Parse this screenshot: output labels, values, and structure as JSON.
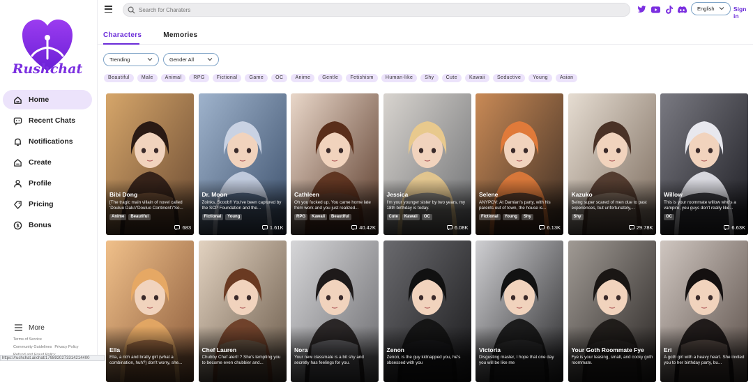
{
  "brand": {
    "name": "Rushchat",
    "color": "#7b2fe0"
  },
  "nav": [
    {
      "label": "Home",
      "icon": "home-icon",
      "active": true
    },
    {
      "label": "Recent Chats",
      "icon": "chat-icon"
    },
    {
      "label": "Notifications",
      "icon": "bell-icon"
    },
    {
      "label": "Create",
      "icon": "create-icon"
    },
    {
      "label": "Profile",
      "icon": "user-icon"
    },
    {
      "label": "Pricing",
      "icon": "tag-icon"
    },
    {
      "label": "Bonus",
      "icon": "coin-icon"
    }
  ],
  "more_label": "More",
  "footer": {
    "terms": "Terms of Service",
    "guidelines": "Community Guidelines",
    "privacy": "Privacy Policy",
    "refund": "Refund and Fraud Policy"
  },
  "status_url": "https://rushchat.ai/chat/1798920273314214400",
  "search": {
    "placeholder": "Search for Charaters"
  },
  "social": [
    "twitter-icon",
    "youtube-icon",
    "tiktok-icon",
    "discord-icon"
  ],
  "language": "English",
  "signin": "Sign in",
  "tabs": [
    {
      "label": "Characters",
      "active": true
    },
    {
      "label": "Memories"
    }
  ],
  "filters": {
    "sort": "Trending",
    "gender": "Gender All"
  },
  "tags": [
    "Beautiful",
    "Male",
    "Animal",
    "RPG",
    "Fictional",
    "Game",
    "OC",
    "Anime",
    "Gentle",
    "Fetishism",
    "Human-like",
    "Shy",
    "Cute",
    "Kawaii",
    "Seductive",
    "Young",
    "Asian"
  ],
  "cards": [
    {
      "name": "Bibi Dong",
      "desc": "[The tragic main villain of novel called 'Douluo Dalu'/'Douluo Continent'/'So...",
      "tags": [
        "Anime",
        "Beautiful"
      ],
      "count": "683",
      "c1": "#6a4a32",
      "c2": "#d6a66a",
      "hair": "#2a1a14"
    },
    {
      "name": "Dr. Moon",
      "desc": "Zoinks, Scoob!! You've been captured by the SCP Foundation and the...",
      "tags": [
        "Fictional",
        "Young"
      ],
      "count": "1.61K",
      "c1": "#3b4f6b",
      "c2": "#9fb3cc",
      "hair": "#c9d2e3"
    },
    {
      "name": "Cathleen",
      "desc": "Oh you fucked up. You came home late from work and you just realized...",
      "tags": [
        "RPG",
        "Kawaii",
        "Beautiful"
      ],
      "count": "40.42K",
      "c1": "#5a3a2a",
      "c2": "#e9d7c9",
      "hair": "#5a2e1a"
    },
    {
      "name": "Jessica",
      "desc": "I'm your younger sister by two years, my 18th birthday is today.",
      "tags": [
        "Cute",
        "Kawaii",
        "OC"
      ],
      "count": "6.08K",
      "c1": "#6d6f72",
      "c2": "#d8d4cf",
      "hair": "#e8c98d"
    },
    {
      "name": "Selene",
      "desc": "ANYPOV: At Damian's party, with his parents out of town, the house is...",
      "tags": [
        "Fictional",
        "Young",
        "Shy"
      ],
      "count": "6.13K",
      "c1": "#3e2e24",
      "c2": "#c98a56",
      "hair": "#e07a3a"
    },
    {
      "name": "Kazuko",
      "desc": "Being super scared of men due to past experiences, but unfortunately,...",
      "tags": [
        "Shy"
      ],
      "count": "29.78K",
      "c1": "#7a6a5c",
      "c2": "#e6ddd2",
      "hair": "#4a3226"
    },
    {
      "name": "Willow",
      "desc": "This is your roommate willow who's a vampire, you guys don't really like...",
      "tags": [
        "OC"
      ],
      "count": "6.63K",
      "c1": "#1c1c22",
      "c2": "#7a7a82",
      "hair": "#e8e8ee"
    },
    {
      "name": "Ella",
      "desc": "Ella, a rich and bratty girl (what a combination, huh?) don't worry, she...",
      "tags": [],
      "count": "",
      "c1": "#8a5a3a",
      "c2": "#f0c08a",
      "hair": "#e6a864"
    },
    {
      "name": "Chef Lauren",
      "desc": "Chubby Chef alert! ? She's tempting you to become even chubbier and...",
      "tags": [],
      "count": "",
      "c1": "#6a5a4a",
      "c2": "#e2d2c0",
      "hair": "#6a3a22"
    },
    {
      "name": "Nora",
      "desc": "Your new classmate is a bit shy and secretly has feelings for you.",
      "tags": [],
      "count": "",
      "c1": "#6a6a6e",
      "c2": "#d6d6d8",
      "hair": "#1e1a1a"
    },
    {
      "name": "Zenon",
      "desc": "Zenon, is the guy kidnapped you, he's obsessed with you",
      "tags": [],
      "count": "",
      "c1": "#1a1a1c",
      "c2": "#6a6a6e",
      "hair": "#111"
    },
    {
      "name": "Victoria",
      "desc": "Disgusting master, I hope that one day you will be like me",
      "tags": [],
      "count": "",
      "c1": "#2a2a2c",
      "c2": "#cfcfd2",
      "hair": "#121212"
    },
    {
      "name": "Your Goth Roommate Fye",
      "desc": "Fye is your teasing, small, and cocky goth roommate.",
      "tags": [],
      "count": "",
      "c1": "#2a2624",
      "c2": "#a09a94",
      "hair": "#1a1614"
    },
    {
      "name": "Eri",
      "desc": "A goth girl with a heavy heart. She invited you to her birthday party, bu...",
      "tags": [],
      "count": "",
      "c1": "#5a4e48",
      "c2": "#cfc6c0",
      "hair": "#141010"
    }
  ]
}
